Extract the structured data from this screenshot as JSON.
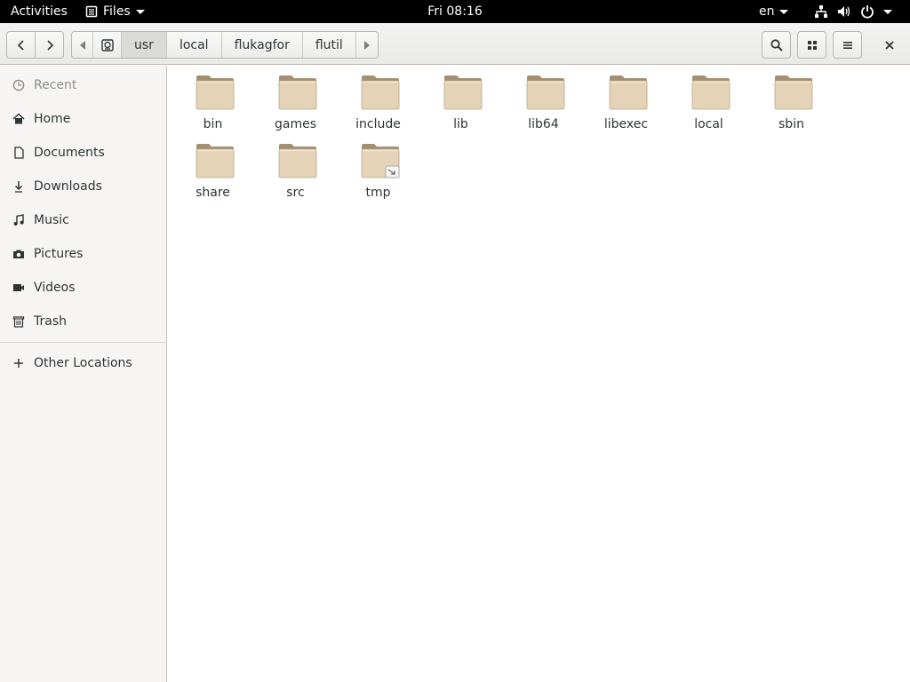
{
  "topbar": {
    "activities": "Activities",
    "app_menu": "Files",
    "clock": "Fri 08:16",
    "language": "en"
  },
  "header": {
    "path": [
      "usr",
      "local",
      "flukagfor",
      "flutil"
    ],
    "active_segment": "usr"
  },
  "sidebar": {
    "items": [
      {
        "label": "Recent",
        "icon": "clock-icon"
      },
      {
        "label": "Home",
        "icon": "home-icon"
      },
      {
        "label": "Documents",
        "icon": "document-icon"
      },
      {
        "label": "Downloads",
        "icon": "download-icon"
      },
      {
        "label": "Music",
        "icon": "music-icon"
      },
      {
        "label": "Pictures",
        "icon": "camera-icon"
      },
      {
        "label": "Videos",
        "icon": "video-icon"
      },
      {
        "label": "Trash",
        "icon": "trash-icon"
      }
    ],
    "other_locations": "Other Locations"
  },
  "files": [
    {
      "name": "bin"
    },
    {
      "name": "games"
    },
    {
      "name": "include"
    },
    {
      "name": "lib"
    },
    {
      "name": "lib64"
    },
    {
      "name": "libexec"
    },
    {
      "name": "local"
    },
    {
      "name": "sbin"
    },
    {
      "name": "share"
    },
    {
      "name": "src"
    },
    {
      "name": "tmp",
      "symlink": true
    }
  ],
  "colors": {
    "folder_body": "#e5d3b7",
    "folder_tab": "#a48f72",
    "topbar_bg": "#000000",
    "sidebar_bg": "#f6f5f4"
  }
}
